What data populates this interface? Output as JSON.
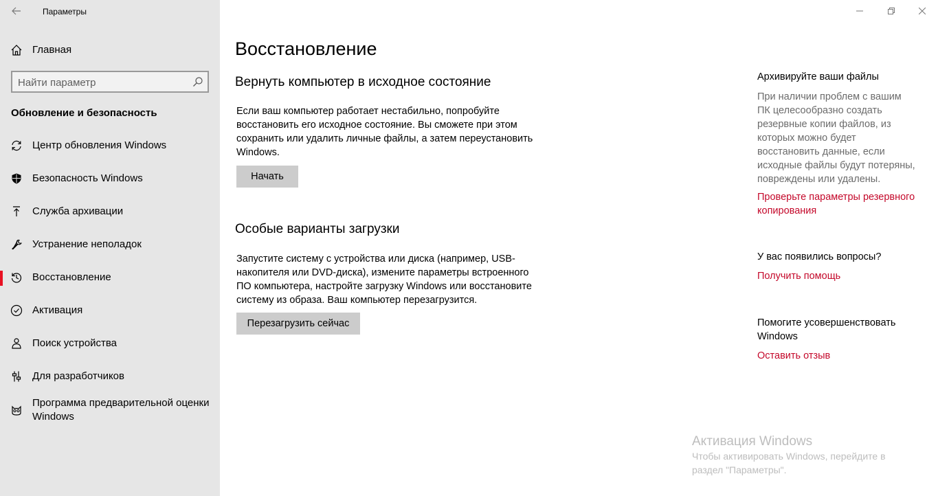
{
  "window": {
    "title": "Параметры",
    "controls": {
      "minimize": "—",
      "restore": "❐",
      "close": "✕"
    }
  },
  "sidebar": {
    "home": "Главная",
    "search": {
      "placeholder": "Найти параметр",
      "value": ""
    },
    "section_title": "Обновление и безопасность",
    "items": [
      {
        "label": "Центр обновления Windows",
        "icon": "sync-icon"
      },
      {
        "label": "Безопасность Windows",
        "icon": "shield-icon"
      },
      {
        "label": "Служба архивации",
        "icon": "backup-arrow-icon"
      },
      {
        "label": "Устранение неполадок",
        "icon": "wrench-icon"
      },
      {
        "label": "Восстановление",
        "icon": "history-icon",
        "active": true
      },
      {
        "label": "Активация",
        "icon": "check-circle-icon"
      },
      {
        "label": "Поиск устройства",
        "icon": "person-pin-icon"
      },
      {
        "label": "Для разработчиков",
        "icon": "developer-sliders-icon"
      },
      {
        "label_line1": "Программа предварительной оценки",
        "label_line2": "Windows",
        "icon": "insider-cat-icon"
      }
    ]
  },
  "main": {
    "title": "Восстановление",
    "reset": {
      "heading": "Вернуть компьютер в исходное состояние",
      "line1": "Если ваш компьютер работает нестабильно, попробуйте",
      "line2": "восстановить его исходное состояние. Вы сможете при этом",
      "line3": "сохранить или удалить личные файлы, а затем переустановить",
      "line4": "Windows.",
      "button": "Начать"
    },
    "advanced": {
      "heading": "Особые варианты загрузки",
      "line1": "Запустите систему с устройства или диска (например, USB-",
      "line2": "накопителя или DVD-диска), измените параметры встроенного",
      "line3": "ПО компьютера, настройте загрузку Windows или восстановите",
      "line4": "систему из образа. Ваш компьютер перезагрузится.",
      "button": "Перезагрузить сейчас"
    }
  },
  "aside": {
    "backup": {
      "heading": "Архивируйте ваши файлы",
      "lines": [
        "При наличии проблем с вашим",
        "ПК целесообразно создать",
        "резервные копии файлов, из",
        "которых можно будет",
        "восстановить данные, если",
        "исходные файлы будут потеряны,",
        "повреждены или удалены."
      ],
      "link_line1": "Проверьте параметры резервного",
      "link_line2": "копирования"
    },
    "questions": {
      "heading": "У вас появились вопросы?",
      "link": "Получить помощь"
    },
    "improve": {
      "heading_line1": "Помогите усовершенствовать",
      "heading_line2": "Windows",
      "link": "Оставить отзыв"
    }
  },
  "watermark": {
    "title": "Активация Windows",
    "line1": "Чтобы активировать Windows, перейдите в",
    "line2": "раздел \"Параметры\"."
  },
  "colors": {
    "accent": "#e81123",
    "link": "#c4082a",
    "sidebar_bg": "#e6e6e6",
    "button_bg": "#cccccc"
  }
}
